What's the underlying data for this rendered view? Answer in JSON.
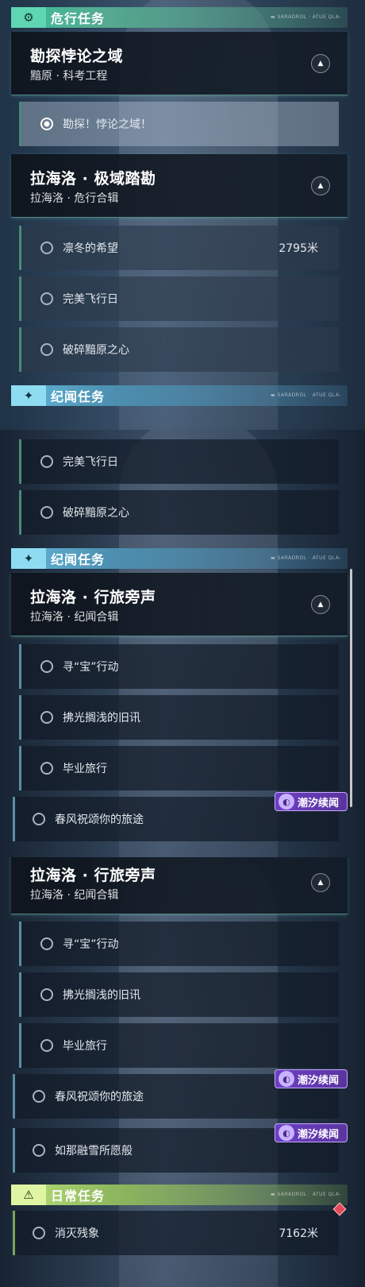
{
  "panel1": {
    "section_weixing": {
      "icon": "gear-eye-icon",
      "title": "危行任务",
      "tag": "▬ SARADROL · ATUE QLA-"
    },
    "header1": {
      "title": "勘探悖论之域",
      "subtitle": "黯原 · 科考工程"
    },
    "quest_selected": {
      "label": "勘探！悖论之域！"
    },
    "header2": {
      "title": "拉海洛 · 极域踏勘",
      "subtitle": "拉海洛 · 危行合辑"
    },
    "quests": [
      {
        "label": "凛冬的希望",
        "distance": "2795米"
      },
      {
        "label": "完美飞行日"
      },
      {
        "label": "破碎黯原之心"
      }
    ],
    "section_jiwen": {
      "icon": "sparkle-icon",
      "title": "纪闻任务",
      "tag": "▬ SARADROL · ATUE QLA-"
    }
  },
  "panel2": {
    "quests_top": [
      {
        "label": "完美飞行日"
      },
      {
        "label": "破碎黯原之心"
      }
    ],
    "section_jiwen": {
      "icon": "sparkle-icon",
      "title": "纪闻任务",
      "tag": "▬ SARADROL · ATUE QLA-"
    },
    "header": {
      "title": "拉海洛 · 行旅旁声",
      "subtitle": "拉海洛 · 纪闻合辑"
    },
    "quests": [
      {
        "label": "寻“宝”行动"
      },
      {
        "label": "拂光搁浅的旧讯"
      },
      {
        "label": "毕业旅行"
      }
    ],
    "badge": "潮汐续闻",
    "quest_long": {
      "label": "春风祝颂你的旅途"
    }
  },
  "panel3": {
    "header": {
      "title": "拉海洛 · 行旅旁声",
      "subtitle": "拉海洛 · 纪闻合辑"
    },
    "quests": [
      {
        "label": "寻“宝”行动"
      },
      {
        "label": "拂光搁浅的旧讯"
      },
      {
        "label": "毕业旅行"
      }
    ],
    "badge1": "潮汐续闻",
    "quest_long1": {
      "label": "春风祝颂你的旅途"
    },
    "badge2": "潮汐续闻",
    "quest_long2": {
      "label": "如那融雪所愿般"
    },
    "section_richang": {
      "icon": "alert-icon",
      "title": "日常任务",
      "tag": "▬ SARADROL · ATUE QLA-"
    },
    "quest_daily": {
      "label": "消灭残象",
      "distance": "7162米"
    }
  },
  "colors": {
    "weixing": "#3fbf9a",
    "jiwen": "#62b8d9",
    "richang": "#b8e07a",
    "badge": "#6b3fc2",
    "marker": "#e24b5a"
  }
}
